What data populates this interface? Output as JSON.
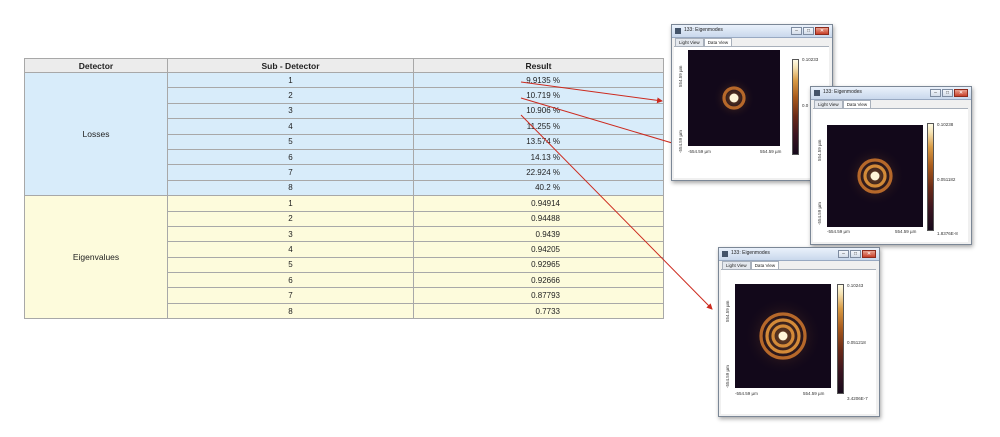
{
  "table": {
    "headers": [
      "Detector",
      "Sub - Detector",
      "Result"
    ],
    "groups": [
      {
        "name": "Losses",
        "rows": [
          {
            "sub": "1",
            "result": "9.9135 %"
          },
          {
            "sub": "2",
            "result": "10.719 %"
          },
          {
            "sub": "3",
            "result": "10.906 %"
          },
          {
            "sub": "4",
            "result": "11.255 %"
          },
          {
            "sub": "5",
            "result": "13.574 %"
          },
          {
            "sub": "6",
            "result": "14.13 %"
          },
          {
            "sub": "7",
            "result": "22.924 %"
          },
          {
            "sub": "8",
            "result": "40.2 %"
          }
        ]
      },
      {
        "name": "Eigenvalues",
        "rows": [
          {
            "sub": "1",
            "result": "0.94914"
          },
          {
            "sub": "2",
            "result": "0.94488"
          },
          {
            "sub": "3",
            "result": "0.9439"
          },
          {
            "sub": "4",
            "result": "0.94205"
          },
          {
            "sub": "5",
            "result": "0.92965"
          },
          {
            "sub": "6",
            "result": "0.92666"
          },
          {
            "sub": "7",
            "result": "0.87793"
          },
          {
            "sub": "8",
            "result": "0.7733"
          }
        ]
      }
    ]
  },
  "windows": [
    {
      "title": "133: Eigenmodes",
      "tabs": [
        "Light View",
        "Data View"
      ],
      "active_tab": "Data View",
      "y_axis_label": "554.59 µm",
      "y_axis_bottom_label": "-554.59 µm",
      "x_axis_left": "-554.59 µm",
      "x_axis_right": "554.59 µm",
      "colorbar_max": "0.10233",
      "colorbar_mid": "0.0",
      "colorbar_min": "",
      "rings": 1
    },
    {
      "title": "133: Eigenmodes",
      "tabs": [
        "Light View",
        "Data View"
      ],
      "active_tab": "Data View",
      "y_axis_label": "554.59 µm",
      "y_axis_bottom_label": "-554.59 µm",
      "x_axis_left": "-554.59 µm",
      "x_axis_right": "554.59 µm",
      "colorbar_max": "0.10238",
      "colorbar_mid": "0.051182",
      "colorbar_min": "1.8376E-8",
      "rings": 2
    },
    {
      "title": "133: Eigenmodes",
      "tabs": [
        "Light View",
        "Data View"
      ],
      "active_tab": "Data View",
      "y_axis_label": "554.59 µm",
      "y_axis_bottom_label": "-554.59 µm",
      "x_axis_left": "-554.59 µm",
      "x_axis_right": "554.59 µm",
      "colorbar_max": "0.10243",
      "colorbar_mid": "0.051218",
      "colorbar_min": "3.4206E-7",
      "rings": 3
    }
  ],
  "colors": {
    "arrow": "#cc2a1e",
    "loss_bg": "#d8ecfa",
    "eig_bg": "#fdfbdc"
  }
}
